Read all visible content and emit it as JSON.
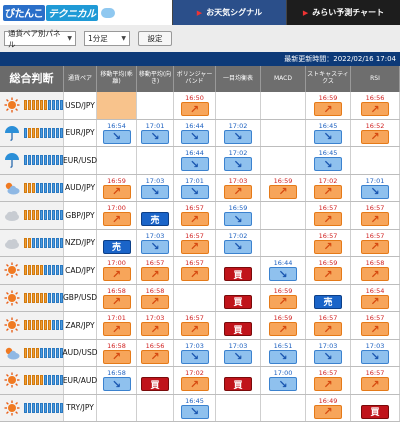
{
  "header": {
    "logo_part1": "ぴたんこ",
    "logo_part2": "テクニカル",
    "tabs": [
      {
        "label": "お天気シグナル",
        "active": true
      },
      {
        "label": "みらい予測チャート",
        "active": false
      }
    ]
  },
  "controls": {
    "panel_select": "通貨ペア別パネル",
    "timeframe_select": "1分足",
    "set_button": "設定"
  },
  "updated": "最新更新時間：2022/02/16 17:04",
  "columns": [
    "総合判断",
    "通貨ペア",
    "移動平均(乖離)",
    "移動平均(向き)",
    "ボリンジャーバンド",
    "一目均衡表",
    "MACD",
    "ストキャスティクス",
    "RSI"
  ],
  "colors": {
    "orange": "#f29b2e",
    "blue": "#4a9be0",
    "buy": "#c0141b",
    "sell": "#1a64c8",
    "header": "#0d3a78"
  },
  "rows": [
    {
      "pair": "USD/JPY",
      "weather": "sun",
      "bars": [
        "or",
        "or",
        "or",
        "or",
        "or",
        "or",
        "bl",
        "bl",
        "bl",
        "bl"
      ],
      "cells": [
        {
          "t": "",
          "s": "blank"
        },
        {
          "t": "",
          "s": ""
        },
        {
          "t": "16:50",
          "s": "up"
        },
        {
          "t": "",
          "s": ""
        },
        {
          "t": "",
          "s": ""
        },
        {
          "t": "16:59",
          "s": "up"
        },
        {
          "t": "16:56",
          "s": "up"
        }
      ]
    },
    {
      "pair": "EUR/JPY",
      "weather": "umbrella",
      "bars": [
        "bl",
        "or",
        "or",
        "or",
        "bl",
        "bl",
        "bl",
        "bl",
        "bl",
        "bl"
      ],
      "cells": [
        {
          "t": "16:54",
          "s": "dn"
        },
        {
          "t": "17:01",
          "s": "dn"
        },
        {
          "t": "16:44",
          "s": "dn"
        },
        {
          "t": "17:02",
          "s": "dn"
        },
        {
          "t": "",
          "s": ""
        },
        {
          "t": "16:45",
          "s": "dn"
        },
        {
          "t": "16:52",
          "s": "up"
        }
      ]
    },
    {
      "pair": "EUR/USD",
      "weather": "umbrella",
      "bars": [
        "bl",
        "bl",
        "bl",
        "bl",
        "bl",
        "bl",
        "bl",
        "bl",
        "bl",
        "bl"
      ],
      "cells": [
        {
          "t": "",
          "s": ""
        },
        {
          "t": "",
          "s": ""
        },
        {
          "t": "16:44",
          "s": "dn"
        },
        {
          "t": "17:02",
          "s": "dn"
        },
        {
          "t": "",
          "s": ""
        },
        {
          "t": "16:45",
          "s": "dn"
        },
        {
          "t": "",
          "s": ""
        }
      ]
    },
    {
      "pair": "AUD/JPY",
      "weather": "cloudsun",
      "bars": [
        "or",
        "or",
        "or",
        "bl",
        "bl",
        "bl",
        "bl",
        "bl",
        "bl",
        "bl"
      ],
      "cells": [
        {
          "t": "16:59",
          "s": "up"
        },
        {
          "t": "17:03",
          "s": "dn"
        },
        {
          "t": "17:01",
          "s": "dn"
        },
        {
          "t": "17:03",
          "s": "up"
        },
        {
          "t": "16:59",
          "s": "up"
        },
        {
          "t": "17:02",
          "s": "up"
        },
        {
          "t": "17:01",
          "s": "dn"
        }
      ]
    },
    {
      "pair": "GBP/JPY",
      "weather": "cloud",
      "bars": [
        "or",
        "or",
        "or",
        "or",
        "bl",
        "bl",
        "bl",
        "bl",
        "bl",
        "bl"
      ],
      "cells": [
        {
          "t": "17:00",
          "s": "up"
        },
        {
          "t": "",
          "s": "sell"
        },
        {
          "t": "16:57",
          "s": "up"
        },
        {
          "t": "16:59",
          "s": "dn"
        },
        {
          "t": "",
          "s": ""
        },
        {
          "t": "16:57",
          "s": "up"
        },
        {
          "t": "16:57",
          "s": "up"
        }
      ]
    },
    {
      "pair": "NZD/JPY",
      "weather": "cloud",
      "bars": [
        "or",
        "or",
        "bl",
        "bl",
        "bl",
        "bl",
        "bl",
        "bl",
        "bl",
        "bl"
      ],
      "cells": [
        {
          "t": "",
          "s": "sell"
        },
        {
          "t": "17:03",
          "s": "dn"
        },
        {
          "t": "16:57",
          "s": "up"
        },
        {
          "t": "17:02",
          "s": "dn"
        },
        {
          "t": "",
          "s": ""
        },
        {
          "t": "16:57",
          "s": "up"
        },
        {
          "t": "16:57",
          "s": "up"
        }
      ]
    },
    {
      "pair": "CAD/JPY",
      "weather": "sun",
      "bars": [
        "or",
        "or",
        "or",
        "or",
        "or",
        "bl",
        "bl",
        "bl",
        "bl",
        "bl"
      ],
      "cells": [
        {
          "t": "17:00",
          "s": "up"
        },
        {
          "t": "16:57",
          "s": "up"
        },
        {
          "t": "16:57",
          "s": "up"
        },
        {
          "t": "",
          "s": "buy"
        },
        {
          "t": "16:44",
          "s": "dn"
        },
        {
          "t": "16:59",
          "s": "up"
        },
        {
          "t": "16:58",
          "s": "up"
        }
      ]
    },
    {
      "pair": "GBP/USD",
      "weather": "sun",
      "bars": [
        "or",
        "or",
        "or",
        "or",
        "or",
        "or",
        "bl",
        "bl",
        "bl",
        "bl"
      ],
      "cells": [
        {
          "t": "16:58",
          "s": "up"
        },
        {
          "t": "16:58",
          "s": "up"
        },
        {
          "t": "",
          "s": ""
        },
        {
          "t": "",
          "s": "buy"
        },
        {
          "t": "16:59",
          "s": "up"
        },
        {
          "t": "",
          "s": "sell"
        },
        {
          "t": "16:54",
          "s": "up"
        }
      ]
    },
    {
      "pair": "ZAR/JPY",
      "weather": "sun",
      "bars": [
        "or",
        "or",
        "or",
        "or",
        "or",
        "or",
        "or",
        "bl",
        "bl",
        "bl"
      ],
      "cells": [
        {
          "t": "17:01",
          "s": "up"
        },
        {
          "t": "17:03",
          "s": "up"
        },
        {
          "t": "16:57",
          "s": "up"
        },
        {
          "t": "",
          "s": "buy"
        },
        {
          "t": "16:59",
          "s": "up"
        },
        {
          "t": "16:57",
          "s": "up"
        },
        {
          "t": "16:57",
          "s": "up"
        }
      ]
    },
    {
      "pair": "AUD/USD",
      "weather": "cloudsun",
      "bars": [
        "or",
        "or",
        "or",
        "or",
        "bl",
        "bl",
        "bl",
        "bl",
        "bl",
        "bl"
      ],
      "cells": [
        {
          "t": "16:58",
          "s": "up"
        },
        {
          "t": "16:56",
          "s": "up"
        },
        {
          "t": "17:03",
          "s": "dn"
        },
        {
          "t": "17:03",
          "s": "dn"
        },
        {
          "t": "16:51",
          "s": "dn"
        },
        {
          "t": "17:03",
          "s": "dn"
        },
        {
          "t": "17:03",
          "s": "dn"
        }
      ]
    },
    {
      "pair": "EUR/AUD",
      "weather": "sun",
      "bars": [
        "or",
        "or",
        "or",
        "or",
        "or",
        "bl",
        "bl",
        "bl",
        "bl",
        "bl"
      ],
      "cells": [
        {
          "t": "16:58",
          "s": "dn"
        },
        {
          "t": "",
          "s": "buy"
        },
        {
          "t": "17:02",
          "s": "up"
        },
        {
          "t": "",
          "s": "buy"
        },
        {
          "t": "17:00",
          "s": "dn"
        },
        {
          "t": "16:57",
          "s": "up"
        },
        {
          "t": "16:57",
          "s": "up"
        }
      ]
    },
    {
      "pair": "TRY/JPY",
      "weather": "sun",
      "bars": [
        "bl",
        "bl",
        "bl",
        "bl",
        "bl",
        "bl",
        "bl",
        "bl",
        "bl",
        "bl"
      ],
      "cells": [
        {
          "t": "",
          "s": ""
        },
        {
          "t": "",
          "s": ""
        },
        {
          "t": "16:45",
          "s": "dn"
        },
        {
          "t": "",
          "s": ""
        },
        {
          "t": "",
          "s": ""
        },
        {
          "t": "16:49",
          "s": "up"
        },
        {
          "t": "",
          "s": "buy"
        }
      ]
    }
  ],
  "labels": {
    "buy": "買",
    "sell": "売"
  }
}
